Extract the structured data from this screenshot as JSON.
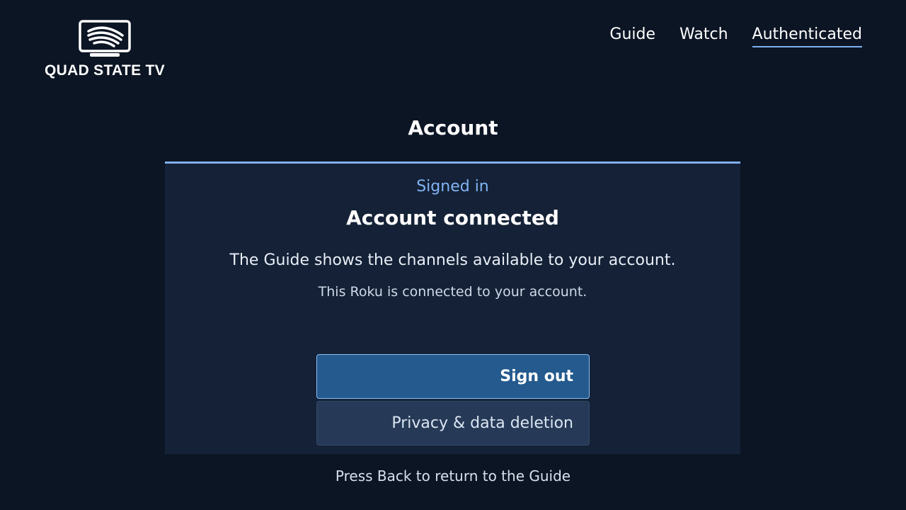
{
  "brand": {
    "name": "QUAD STATE TV",
    "logo_icon": "tv-icon"
  },
  "nav": {
    "items": [
      {
        "label": "Guide",
        "active": false
      },
      {
        "label": "Watch",
        "active": false
      },
      {
        "label": "Authenticated",
        "active": true
      }
    ]
  },
  "page": {
    "title": "Account"
  },
  "panel": {
    "status": "Signed in",
    "heading": "Account connected",
    "description": "The Guide shows the channels available to your account.",
    "subtext": "This Roku is connected to your account.",
    "buttons": {
      "sign_out": "Sign out",
      "privacy": "Privacy & data deletion"
    }
  },
  "footer": {
    "hint": "Press Back to return to the Guide"
  },
  "colors": {
    "background": "#0c1524",
    "panel": "#142136",
    "accent": "#7fb1f1",
    "primary_button": "#245a8d",
    "secondary_button": "#263a57"
  }
}
